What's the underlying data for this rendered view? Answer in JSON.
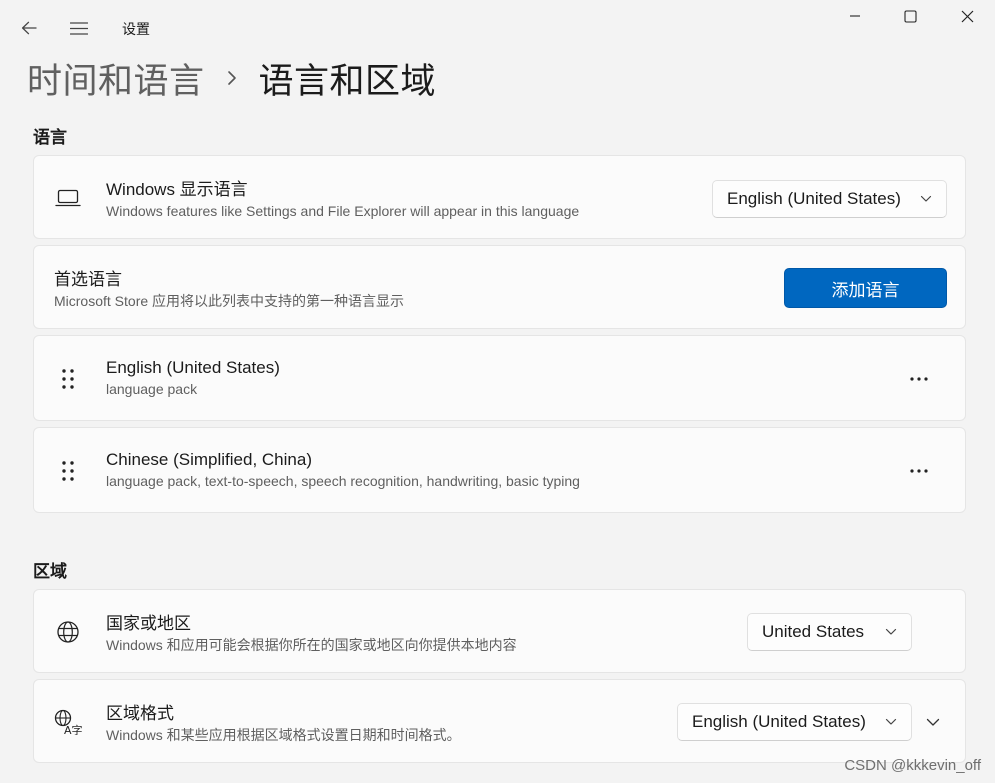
{
  "window": {
    "app_title": "设置",
    "back_icon": "back-arrow-icon",
    "menu_icon": "hamburger-menu-icon",
    "controls": [
      "minimize-icon",
      "maximize-icon",
      "close-icon"
    ]
  },
  "breadcrumb": {
    "parent": "时间和语言",
    "current": "语言和区域"
  },
  "language_section": {
    "title": "语言",
    "display_language": {
      "title": "Windows 显示语言",
      "subtitle": "Windows features like Settings and File Explorer will appear in this language",
      "value": "English (United States)",
      "icon": "laptop-icon"
    },
    "preferred": {
      "title": "首选语言",
      "subtitle": "Microsoft Store 应用将以此列表中支持的第一种语言显示",
      "button": "添加语言"
    },
    "languages": [
      {
        "name": "English (United States)",
        "features": "language pack"
      },
      {
        "name": "Chinese (Simplified, China)",
        "features": "language pack, text-to-speech, speech recognition, handwriting, basic typing"
      }
    ]
  },
  "region_section": {
    "title": "区域",
    "country": {
      "title": "国家或地区",
      "subtitle": "Windows 和应用可能会根据你所在的国家或地区向你提供本地内容",
      "value": "United States",
      "icon": "globe-icon"
    },
    "format": {
      "title": "区域格式",
      "subtitle": "Windows 和某些应用根据区域格式设置日期和时间格式。",
      "value": "English (United States)",
      "icon": "regional-format-icon"
    }
  },
  "watermark": "CSDN @kkkevin_off",
  "colors": {
    "accent": "#0067c0",
    "background": "#f3f3f3",
    "card": "#fbfbfb"
  }
}
